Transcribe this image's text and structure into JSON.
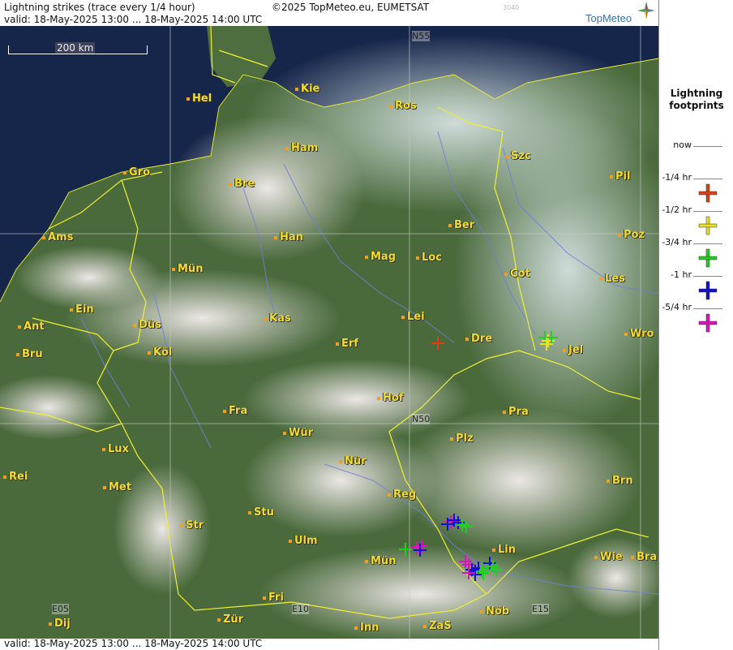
{
  "header": {
    "title": "Lightning strikes (trace every 1/4 hour)",
    "copyright": "©2025 TopMeteo.eu, EUMETSAT",
    "valid": "valid:  18-May-2025 13:00 ... 18-May-2025 14:00 UTC",
    "code": "3040",
    "logo_text": "TopMeteo"
  },
  "footer": {
    "valid": "valid:  18-May-2025 13:00 ... 18-May-2025 14:00 UTC"
  },
  "scale": {
    "label": "200 km"
  },
  "legend": {
    "title_line1": "Lightning",
    "title_line2": "footprints",
    "rows": [
      {
        "label": "now",
        "color": ""
      },
      {
        "label": "-1/4 hr",
        "color": "#e04010"
      },
      {
        "label": "-1/2 hr",
        "color": "#e8e020"
      },
      {
        "label": "-3/4 hr",
        "color": "#20d020"
      },
      {
        "label": "-1 hr",
        "color": "#1010d0"
      },
      {
        "label": "-5/4 hr",
        "color": "#e010c0"
      }
    ]
  },
  "grid_labels": {
    "n55": "N55",
    "n50": "N50",
    "e05": "E05",
    "e10": "E10",
    "e15": "E15"
  },
  "cities": {
    "hel": "Hel",
    "kie": "Kie",
    "ros": "Ros",
    "ham": "Ham",
    "szc": "Szc",
    "gro": "Gro",
    "bre": "Bre",
    "pil": "Pil",
    "ams": "Ams",
    "han": "Han",
    "ber": "Ber",
    "poz": "Poz",
    "mun": "Mün",
    "mag": "Mag",
    "loc": "Loc",
    "cot": "Cot",
    "les": "Les",
    "ein": "Ein",
    "kas": "Kas",
    "lei": "Lei",
    "ant": "Ant",
    "dus": "Düs",
    "wro": "Wro",
    "bru": "Bru",
    "kol": "Köl",
    "erf": "Erf",
    "dre": "Dre",
    "jel": "Jel",
    "hof": "Hof",
    "fra": "Fra",
    "pra": "Pra",
    "lux": "Lux",
    "wur": "Wür",
    "plz": "Plz",
    "rei": "Rei",
    "nur": "Nür",
    "met": "Met",
    "brn": "Brn",
    "reg": "Reg",
    "stu": "Stu",
    "str": "Str",
    "ulm": "Ulm",
    "lin": "Lin",
    "mun2": "Mün",
    "wie": "Wie",
    "bra": "Bra",
    "fri": "Fri",
    "nob": "Nöb",
    "dij": "Dij",
    "zur": "Zür",
    "inn": "Inn",
    "zas": "ZaS"
  }
}
